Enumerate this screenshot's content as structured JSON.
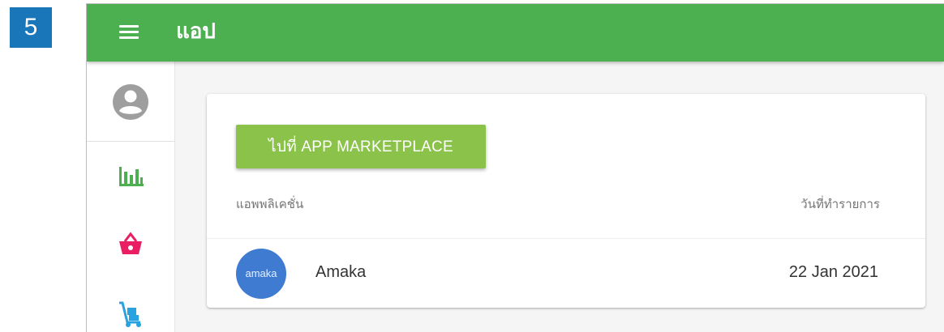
{
  "step_badge": "5",
  "appbar": {
    "title": "แอป",
    "menu_icon": "hamburger-menu-icon",
    "color": "#4caf50"
  },
  "sidebar": {
    "items": [
      {
        "icon": "account-circle-icon",
        "color": "#9e9e9e"
      },
      {
        "icon": "bar-chart-icon",
        "color": "#4caf50"
      },
      {
        "icon": "shopping-basket-icon",
        "color": "#e91e63"
      },
      {
        "icon": "hand-truck-icon",
        "color": "#29a3e0"
      }
    ]
  },
  "card": {
    "marketplace_button": "ไปที่ APP MARKETPLACE",
    "button_color": "#8bc34a",
    "columns": {
      "application": "แอพพลิเคชั่น",
      "date": "วันที่ทำรายการ"
    },
    "rows": [
      {
        "avatar_text": "amaka",
        "name": "Amaka",
        "date": "22 Jan 2021"
      }
    ]
  }
}
